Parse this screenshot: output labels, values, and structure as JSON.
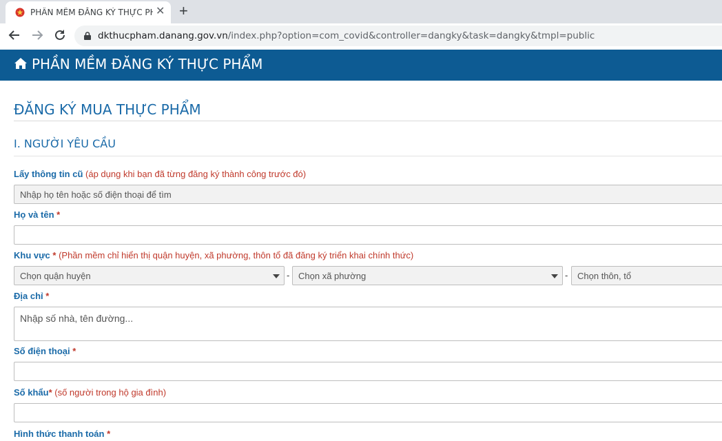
{
  "browser": {
    "tab_title": "PHẦN MỀM ĐĂNG KÝ THỰC PHẨ",
    "url_host": "dkthucpham.danang.gov.vn",
    "url_path": "/index.php?option=com_covid&controller=dangky&task=dangky&tmpl=public"
  },
  "app": {
    "title": "PHẦN MỀM ĐĂNG KÝ THỰC PHẨM"
  },
  "page": {
    "title": "ĐĂNG KÝ MUA THỰC PHẨM",
    "section": "I. NGƯỜI YÊU CẦU"
  },
  "form": {
    "old_info": {
      "label": "Lấy thông tin cũ",
      "note": "(áp dụng khi bạn đã từng đăng ký thành công trước đó)",
      "placeholder": "Nhập họ tên hoặc số điện thoại để tìm"
    },
    "name": {
      "label": "Họ và tên",
      "required": "*"
    },
    "area": {
      "label": "Khu vực",
      "required": "*",
      "note": "(Phần mềm chỉ hiển thị quận huyện, xã phường, thôn tổ đã đăng ký triển khai chính thức)",
      "district": "Chọn quận huyện",
      "ward": "Chọn xã phường",
      "hamlet": "Chọn thôn, tổ",
      "separator": "-"
    },
    "address": {
      "label": "Địa chỉ",
      "required": "*",
      "placeholder": "Nhập số nhà, tên đường..."
    },
    "phone": {
      "label": "Số điện thoại",
      "required": "*"
    },
    "household": {
      "label": "Số khẩu",
      "required": "*",
      "note": "(số người trong hộ gia đình)"
    },
    "payment": {
      "label": "Hình thức thanh toán",
      "required": "*"
    }
  },
  "colors": {
    "header_bg": "#0d5b93",
    "accent": "#1a6aa8",
    "required": "#c0392b"
  }
}
